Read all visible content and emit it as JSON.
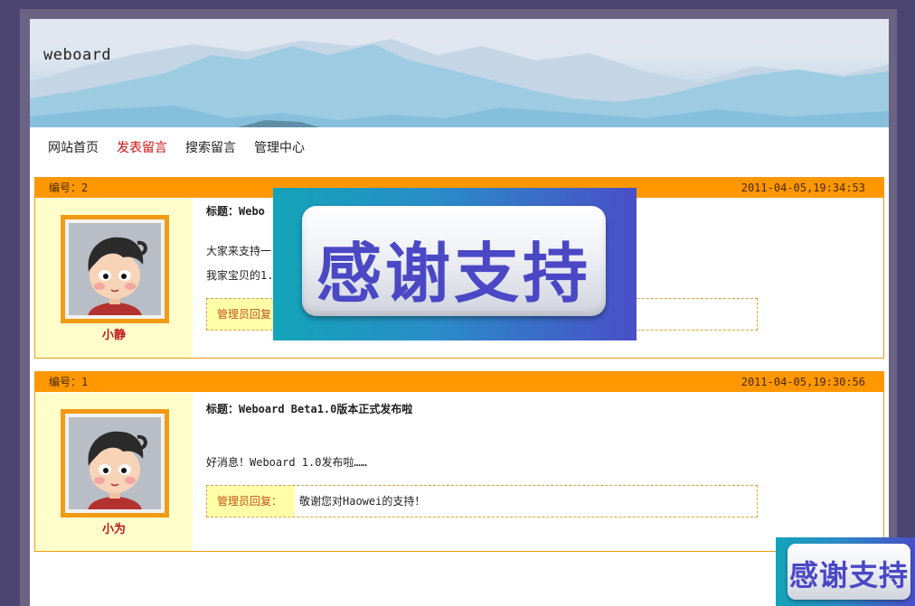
{
  "site": {
    "title": "weboard"
  },
  "nav": {
    "items": [
      {
        "label": "网站首页"
      },
      {
        "label": "发表留言"
      },
      {
        "label": "搜索留言"
      },
      {
        "label": "管理中心"
      }
    ],
    "active_index": 1
  },
  "messages": [
    {
      "id_label": "编号：2",
      "time": "2011-04-05,19:34:53",
      "user": "小静",
      "title": "标题：Webo",
      "lines": [
        "大家来支持一",
        "我家宝贝的1."
      ],
      "reply_label": "管理员回复："
    },
    {
      "id_label": "编号：1",
      "time": "2011-04-05,19:30:56",
      "user": "小为",
      "title": "标题：Weboard Beta1.0版本正式发布啦",
      "lines": [
        "好消息！Weboard 1.0发布啦……"
      ],
      "reply_label": "管理员回复：",
      "reply": "敬谢您对Haowei的支持！"
    }
  ],
  "overlay": {
    "text": "感谢支持"
  },
  "corner_badge": {
    "text": "感谢支持"
  },
  "colors": {
    "accent": "#ff9800",
    "nav_active": "#cc1111",
    "username": "#c4161c",
    "side_bg": "#fffecb"
  }
}
